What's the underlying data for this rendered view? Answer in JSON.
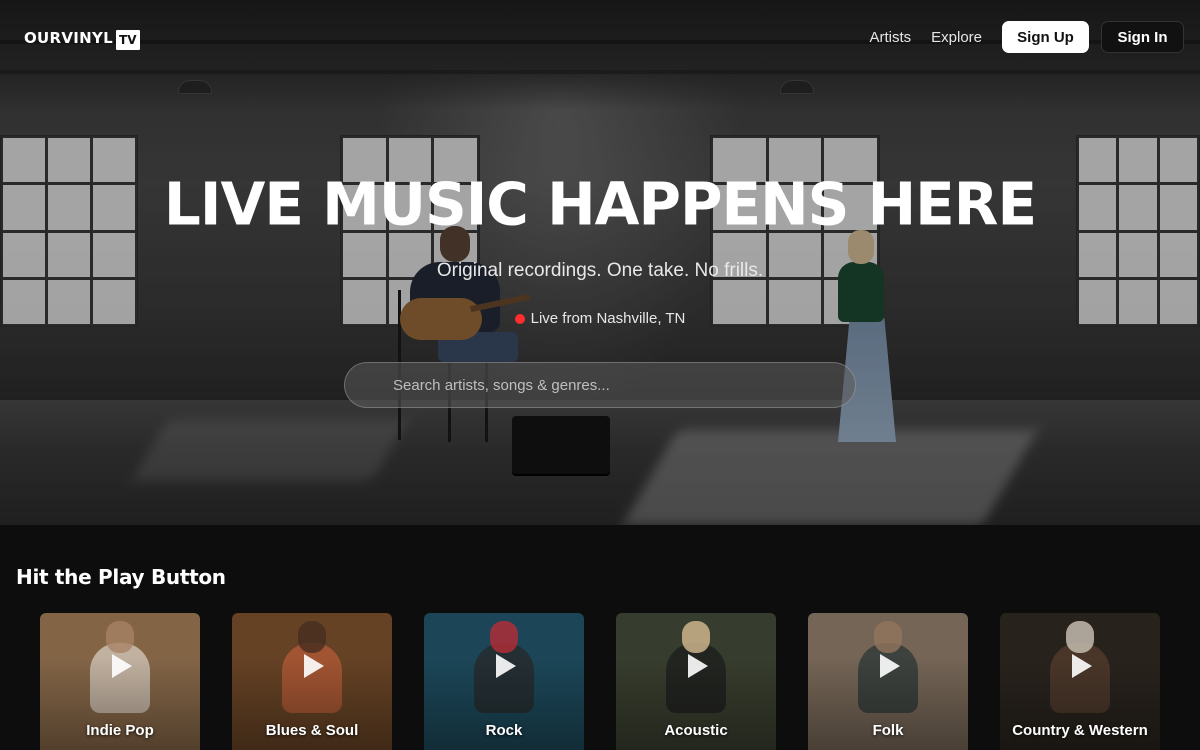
{
  "header": {
    "logo_text": "OURVINYL",
    "logo_badge": "TV",
    "nav": [
      {
        "label": "Artists"
      },
      {
        "label": "Explore"
      }
    ],
    "signup_label": "Sign Up",
    "signin_label": "Sign In"
  },
  "hero": {
    "title": "LIVE MUSIC HAPPENS HERE",
    "subtitle": "Original recordings. One take. No frills.",
    "live_text": "Live from Nashville, TN",
    "live_dot_color": "#ff2d2d",
    "search_placeholder": "Search artists, songs & genres..."
  },
  "section": {
    "title": "Hit the Play Button",
    "genres": [
      {
        "label": "Indie Pop",
        "icon": "play-icon",
        "bg": "#8a6a4a",
        "fig": "#e0d6c8",
        "head": "#b08a6a"
      },
      {
        "label": "Blues & Soul",
        "icon": "play-icon",
        "bg": "#6a4526",
        "fig": "#c0603a",
        "head": "#4a3022"
      },
      {
        "label": "Rock",
        "icon": "play-icon",
        "bg": "#1d4a5c",
        "fig": "#2a2a2a",
        "head": "#c0303a"
      },
      {
        "label": "Acoustic",
        "icon": "play-icon",
        "bg": "#3a4030",
        "fig": "#1e1e1e",
        "head": "#e2c79a"
      },
      {
        "label": "Folk",
        "icon": "play-icon",
        "bg": "#7a6a5a",
        "fig": "#2e3a3a",
        "head": "#9a7a62"
      },
      {
        "label": "Country & Western",
        "icon": "play-icon",
        "bg": "#2a241e",
        "fig": "#5a4030",
        "head": "#d8d0c0"
      }
    ]
  }
}
